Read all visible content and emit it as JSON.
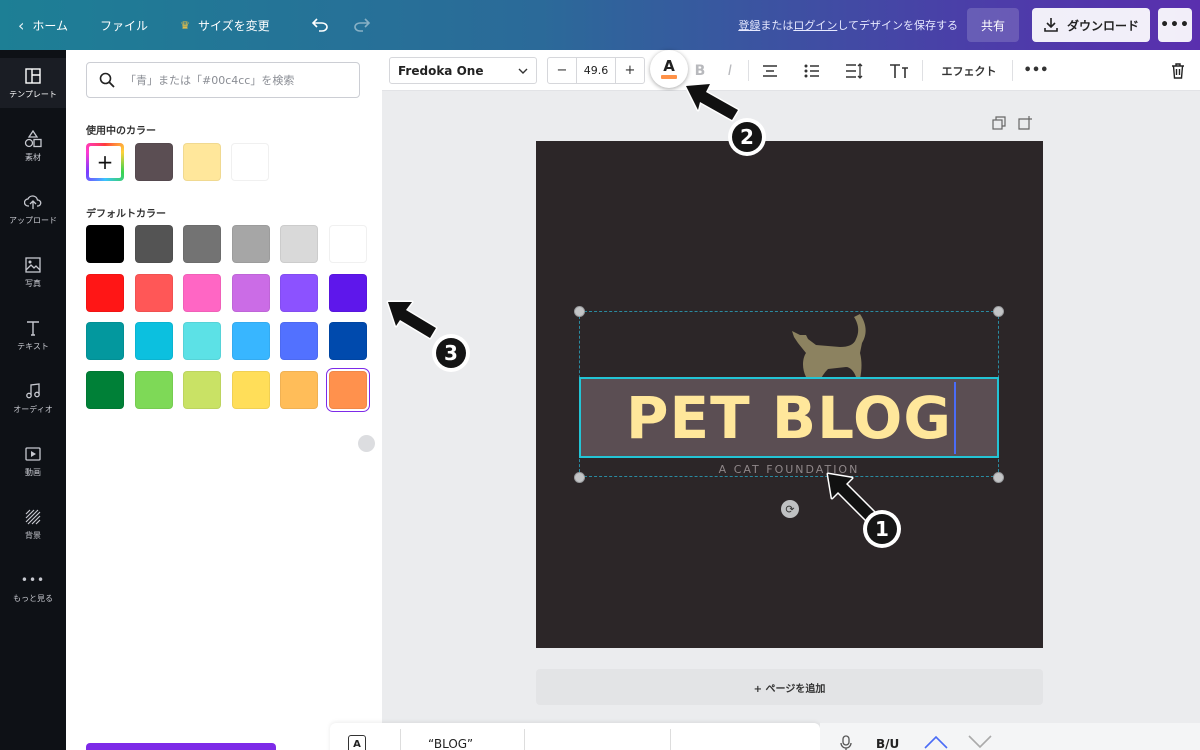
{
  "topbar": {
    "home": "ホーム",
    "file": "ファイル",
    "resize": "サイズを変更",
    "save_prefix": "",
    "save_register": "登録",
    "save_or": "または",
    "save_login": "ログイン",
    "save_suffix": "してデザインを保存する",
    "share": "共有",
    "download": "ダウンロード"
  },
  "rail": {
    "items": [
      {
        "label": "テンプレート",
        "icon": "template-icon"
      },
      {
        "label": "素材",
        "icon": "elements-icon"
      },
      {
        "label": "アップロード",
        "icon": "upload-icon"
      },
      {
        "label": "写真",
        "icon": "photo-icon"
      },
      {
        "label": "テキスト",
        "icon": "text-icon"
      },
      {
        "label": "オーディオ",
        "icon": "audio-icon"
      },
      {
        "label": "動画",
        "icon": "video-icon"
      },
      {
        "label": "背景",
        "icon": "background-icon"
      },
      {
        "label": "もっと見る",
        "icon": "more-icon"
      }
    ]
  },
  "color_panel": {
    "search_placeholder": "「青」または「#00c4cc」を検索",
    "in_use_label": "使用中のカラー",
    "in_use_colors": [
      "#5b4e53",
      "#ffe79b",
      "#ffffff"
    ],
    "default_label": "デフォルトカラー",
    "default_colors": [
      [
        "#000000",
        "#545454",
        "#737373",
        "#a6a6a6",
        "#d9d9d9",
        "#ffffff"
      ],
      [
        "#ff1616",
        "#ff5757",
        "#ff66c4",
        "#cb6ce6",
        "#8c52ff",
        "#5e17eb"
      ],
      [
        "#03989e",
        "#0cc0df",
        "#5ce1e6",
        "#38b6ff",
        "#5271ff",
        "#004aad"
      ],
      [
        "#008037",
        "#7ed957",
        "#c9e265",
        "#ffde59",
        "#ffbd59",
        "#ff914d"
      ]
    ],
    "selected_color": "#ff914d"
  },
  "toolbar": {
    "font": "Fredoka One",
    "font_size": "49.6",
    "minus": "−",
    "plus": "+",
    "text_color_letter": "A",
    "bold": "B",
    "italic": "I",
    "effects": "エフェクト"
  },
  "canvas": {
    "headline": "PET BLOG",
    "tagline": "A CAT FOUNDATION",
    "add_page": "+ ページを追加",
    "page_bg": "#2c2628",
    "text_box_bg": "#5b4e53",
    "headline_color": "#ffe79b"
  },
  "bottombar": {
    "quote": "“BLOG”",
    "bu": "B/U"
  },
  "annotations": [
    "1",
    "2",
    "3"
  ]
}
